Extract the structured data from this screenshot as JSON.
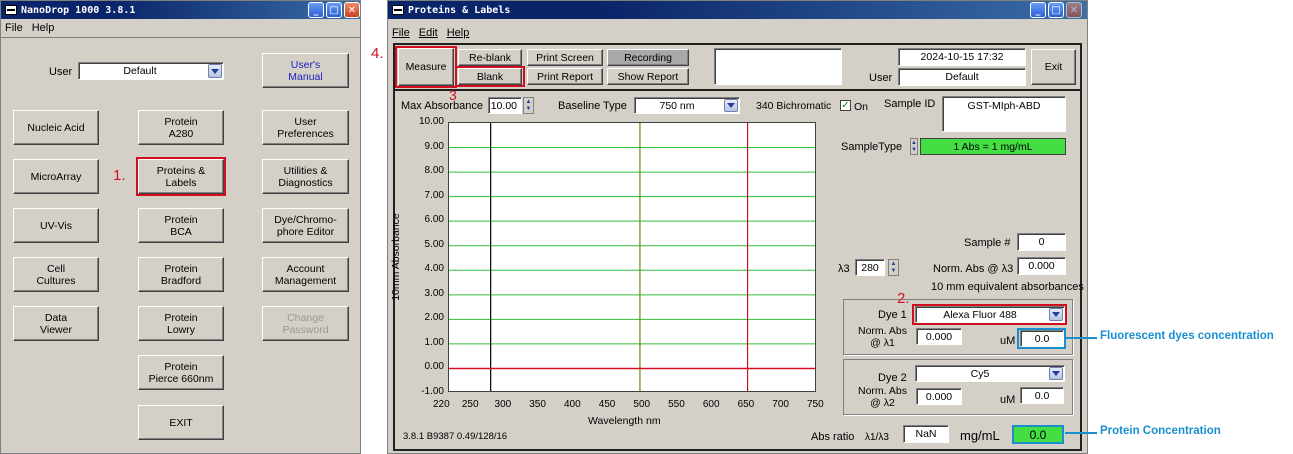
{
  "left_window": {
    "title": "NanoDrop 1000 3.8.1",
    "menu": [
      "File",
      "Help"
    ],
    "user_label": "User",
    "user_value": "Default",
    "buttons": {
      "users_manual": "User's\nManual",
      "nucleic_acid": "Nucleic Acid",
      "protein_a280": "Protein\nA280",
      "user_preferences": "User\nPreferences",
      "microarray": "MicroArray",
      "proteins_labels": "Proteins &\nLabels",
      "utilities": "Utilities &\nDiagnostics",
      "uv_vis": "UV-Vis",
      "protein_bca": "Protein\nBCA",
      "dye_editor": "Dye/Chromo-\nphore Editor",
      "cell_cultures": "Cell\nCultures",
      "protein_bradford": "Protein\nBradford",
      "account_management": "Account\nManagement",
      "data_viewer": "Data\nViewer",
      "protein_lowry": "Protein\nLowry",
      "change_password": "Change\nPassword",
      "protein_pierce": "Protein\nPierce 660nm",
      "exit": "EXIT"
    },
    "callout_1": "1."
  },
  "right_window": {
    "title": "Proteins & Labels",
    "menu": [
      "File",
      "Edit",
      "Help"
    ],
    "toolbar": {
      "measure": "Measure",
      "reblank": "Re-blank",
      "blank": "Blank",
      "print_screen": "Print Screen",
      "print_report": "Print Report",
      "recording": "Recording",
      "show_report": "Show Report",
      "exit": "Exit"
    },
    "datetime": "2024-10-15  17:32",
    "user_label": "User",
    "user_value": "Default",
    "callout_3": "3",
    "callout_4": "4.",
    "max_abs_label": "Max Absorbance",
    "max_abs_value": "10.00",
    "baseline_label": "Baseline Type",
    "baseline_value": "750 nm",
    "bichromatic_label": "340 Bichromatic",
    "on_label": "On",
    "sample_id_label": "Sample ID",
    "sample_id_value": "GST-MIph-ABD",
    "sample_type_label": "SampleType",
    "sample_type_value": "1 Abs = 1 mg/mL",
    "sample_num_label": "Sample #",
    "sample_num_value": "0",
    "lambda3_label": "λ3",
    "lambda3_value": "280",
    "norm_abs_l3_label": "Norm. Abs @ λ3",
    "norm_abs_l3_value": "0.000",
    "equiv_label": "10 mm equivalent absorbances",
    "dye1_label": "Dye 1",
    "dye1_value": "Alexa Fluor 488",
    "dye1_norm_label": "Norm. Abs\n@ λ1",
    "dye1_norm_value": "0.000",
    "dye1_um_label": "uM",
    "dye1_um_value": "0.0",
    "dye2_label": "Dye 2",
    "dye2_value": "Cy5",
    "dye2_norm_label": "Norm. Abs\n@ λ2",
    "dye2_norm_value": "0.000",
    "dye2_um_label": "uM",
    "dye2_um_value": "0.0",
    "callout_2": "2.",
    "version": "3.8.1 B9387 0.49/128/16",
    "abs_ratio_label": "Abs ratio",
    "abs_ratio_sub": "λ1/λ3",
    "abs_ratio_value": "NaN",
    "mgml_label": "mg/mL",
    "mgml_value": "0.0"
  },
  "annotations": {
    "fluorescent": "Fluorescent dyes concentration",
    "protein": "Protein Concentration"
  },
  "chart_data": {
    "type": "line",
    "ylabel": "10mm Absorbance",
    "xlabel": "Wavelength nm",
    "xlim": [
      220,
      750
    ],
    "ylim": [
      -1.0,
      10.0
    ],
    "x_ticks": [
      "220",
      "250",
      "300",
      "350",
      "400",
      "450",
      "500",
      "550",
      "600",
      "650",
      "700",
      "750"
    ],
    "y_ticks": [
      "10.00",
      "9.00",
      "8.00",
      "7.00",
      "6.00",
      "5.00",
      "4.00",
      "3.00",
      "2.00",
      "1.00",
      "0.00",
      "-1.00"
    ],
    "grid": true,
    "markers": [
      {
        "x": 280,
        "color": "#000000"
      },
      {
        "x": 495,
        "color": "#808000"
      },
      {
        "x": 650,
        "color": "#d01020"
      }
    ],
    "series": [
      {
        "x": [
          220,
          750
        ],
        "values": [
          0,
          0
        ],
        "color": "#d01020"
      }
    ]
  }
}
